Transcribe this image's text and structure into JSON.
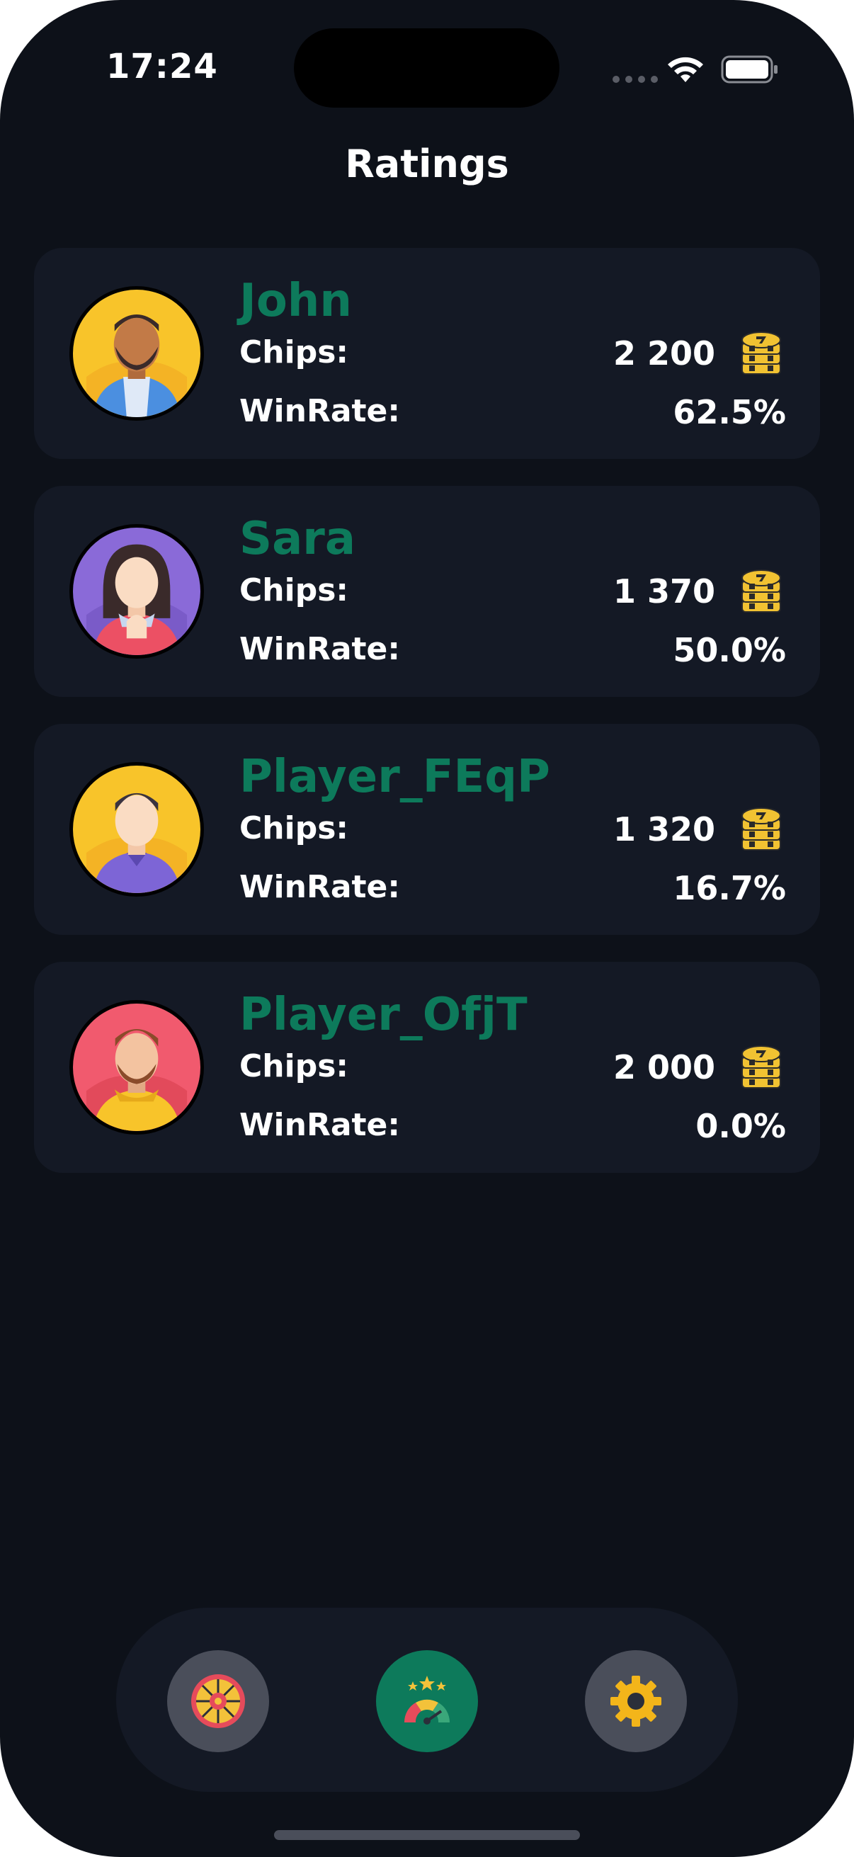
{
  "status_bar": {
    "time": "17:24"
  },
  "header": {
    "title": "Ratings"
  },
  "players": [
    {
      "name": "John",
      "chips_label": "Chips:",
      "chips": "2 200",
      "winrate_label": "WinRate:",
      "winrate": "62.5%",
      "avatar": "man-beard-blue-jacket-avatar",
      "avatar_bg": "#f8c42a"
    },
    {
      "name": "Sara",
      "chips_label": "Chips:",
      "chips": "1 370",
      "winrate_label": "WinRate:",
      "winrate": "50.0%",
      "avatar": "woman-pink-hoodie-avatar",
      "avatar_bg": "#8a6ad8"
    },
    {
      "name": "Player_FEqP",
      "chips_label": "Chips:",
      "chips": "1 320",
      "winrate_label": "WinRate:",
      "winrate": "16.7%",
      "avatar": "man-purple-shirt-avatar",
      "avatar_bg": "#f8c42a"
    },
    {
      "name": "Player_OfjT",
      "chips_label": "Chips:",
      "chips": "2 000",
      "winrate_label": "WinRate:",
      "winrate": "0.0%",
      "avatar": "man-beard-yellow-hoodie-avatar",
      "avatar_bg": "#f15a6e"
    }
  ],
  "chips_icon": "coin-stack-icon",
  "tab_bar": {
    "tabs": [
      {
        "icon": "roulette-icon",
        "active": false
      },
      {
        "icon": "rating-gauge-icon",
        "active": true
      },
      {
        "icon": "gear-icon",
        "active": false
      }
    ]
  },
  "colors": {
    "background": "#0d1119",
    "card": "#141925",
    "accent": "#0d7a5b",
    "inactive_tab": "#4a4e5a"
  }
}
